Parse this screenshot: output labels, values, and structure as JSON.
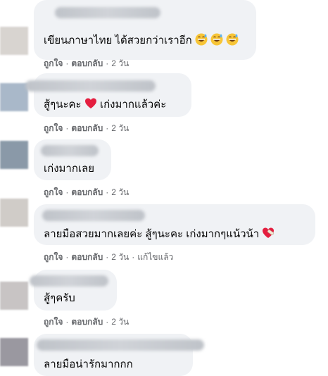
{
  "comments": [
    {
      "text": "เขียนภาษาไทย ได้สวยกว่าเราอีก",
      "emoji": [
        "grinning-sweat-icon",
        "grinning-sweat-icon",
        "grinning-sweat-icon"
      ],
      "like": "ถูกใจ",
      "reply": "ตอบกลับ",
      "time": "2 วัน"
    },
    {
      "text_before": "สู้ๆนะคะ",
      "emoji": [
        "heart-icon"
      ],
      "text_after": "เก่งมากแล้วค่ะ",
      "like": "ถูกใจ",
      "reply": "ตอบกลับ",
      "time": "2 วัน"
    },
    {
      "text": "เก่งมากเลย",
      "like": "ถูกใจ",
      "reply": "ตอบกลับ",
      "time": "2 วัน"
    },
    {
      "text": "ลายมือสวยมากเลยค่ะ สู้ๆนะคะ เก่งมากๆแน้วน้า",
      "emoji": [
        "heart-with-bandage-icon"
      ],
      "like": "ถูกใจ",
      "reply": "ตอบกลับ",
      "time": "2 วัน",
      "edited": "แก้ไขแล้ว"
    },
    {
      "text": "สู้ๆครับ",
      "like": "ถูกใจ",
      "reply": "ตอบกลับ",
      "time": "2 วัน"
    },
    {
      "text": "ลายมือน่ารักมากกก"
    }
  ],
  "colors": {
    "bubble": "#f0f2f5",
    "meta_text": "#65676b",
    "body_text": "#050505",
    "heart": "#e41e3f"
  }
}
